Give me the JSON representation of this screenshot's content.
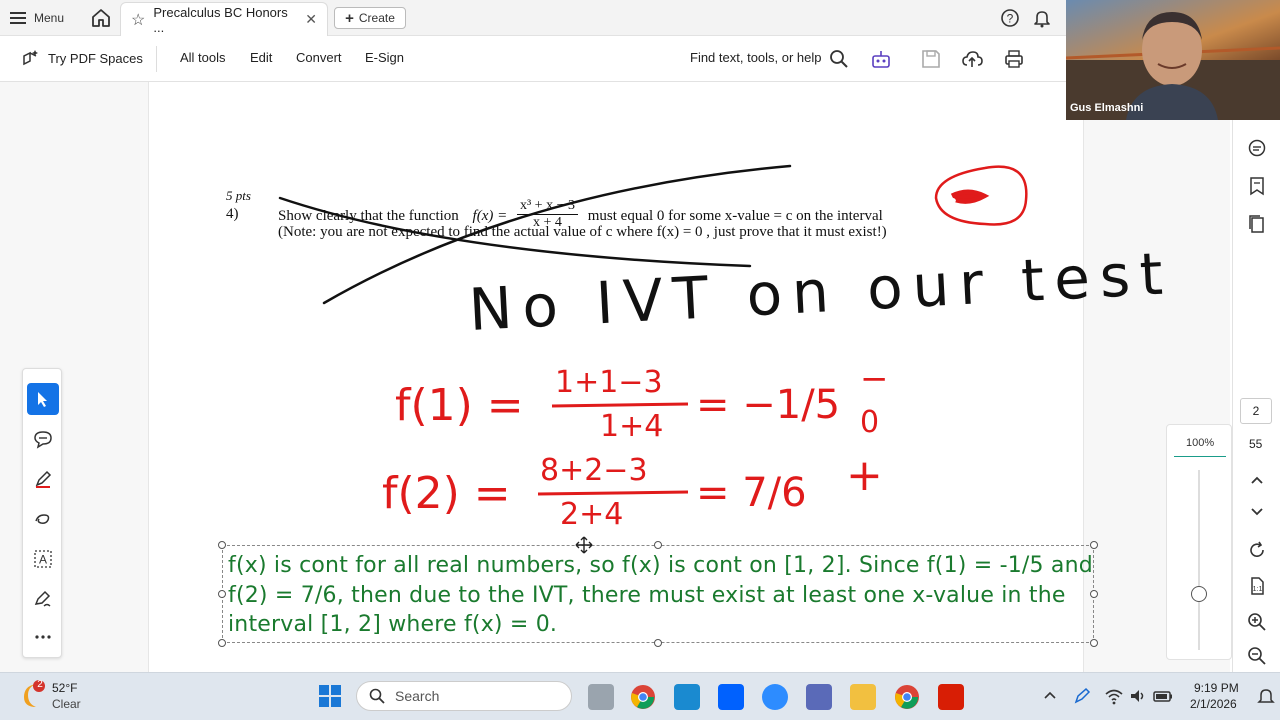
{
  "topbar": {
    "menu_label": "Menu",
    "tab_title": "Precalculus BC Honors ...",
    "tab_close": "✕",
    "create_label": "Create"
  },
  "toolbar": {
    "pdf_spaces": "Try PDF Spaces",
    "all_tools": "All tools",
    "edit": "Edit",
    "convert": "Convert",
    "esign": "E-Sign",
    "find": "Find text, tools, or help"
  },
  "question": {
    "points": "5 pts",
    "number": "4)",
    "line1_a": "Show clearly that the function",
    "line1_fx": "f(x) =",
    "numerator": "x³ + x − 3",
    "denominator": "x + 4",
    "line1_b": "must equal 0 for some x-value = c  on the interval",
    "line2": "(Note:  you are not expected to find the actual value of c  where  f(x) = 0 , just prove that it must exist!)"
  },
  "handwriting": {
    "note": "No IVT on our test",
    "f1_lhs": "f(1) =",
    "f1_num": "1+1−3",
    "f1_den": "1+4",
    "f1_val": "= −1/5",
    "f1_sign": "−",
    "f2_lhs": "f(2) =",
    "f2_num": "8+2−3",
    "f2_den": "2+4",
    "f2_val": "= 7/6",
    "f2_sign": "+"
  },
  "annotation": {
    "text": "f(x) is cont for all real numbers, so f(x) is cont on [1, 2]. Since f(1) = -1/5 and f(2) = 7/6, then due to the IVT, there must exist at least one x-value in the interval [1, 2] where f(x) = 0."
  },
  "zoom": {
    "level": "100%"
  },
  "pages": {
    "current": "2",
    "total": "55"
  },
  "video": {
    "name": "Gus Elmashni"
  },
  "taskbar": {
    "weather_badge": "2",
    "temp": "52°F",
    "condition": "Clear",
    "search": "Search",
    "time": "9:19 PM",
    "date": "2/1/2026"
  },
  "colors": {
    "ink_red": "#e01b1b",
    "ink_black": "#111111",
    "annotation_green": "#1a7a2e",
    "accent_blue": "#1473e6"
  }
}
